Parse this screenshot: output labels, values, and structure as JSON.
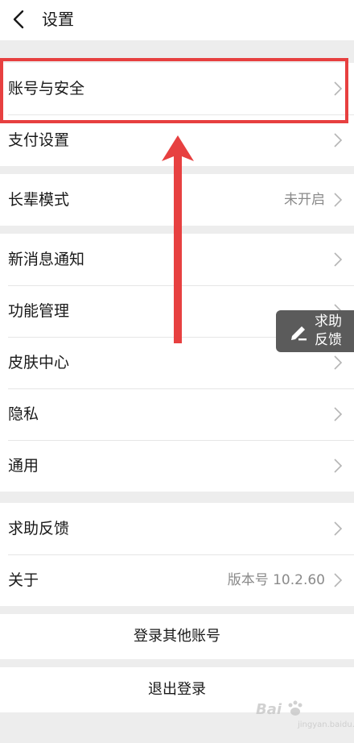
{
  "header": {
    "title": "设置"
  },
  "groups": [
    {
      "items": [
        {
          "label": "账号与安全",
          "value": ""
        },
        {
          "label": "支付设置",
          "value": ""
        }
      ]
    },
    {
      "items": [
        {
          "label": "长辈模式",
          "value": "未开启"
        }
      ]
    },
    {
      "items": [
        {
          "label": "新消息通知",
          "value": ""
        },
        {
          "label": "功能管理",
          "value": ""
        },
        {
          "label": "皮肤中心",
          "value": ""
        },
        {
          "label": "隐私",
          "value": ""
        },
        {
          "label": "通用",
          "value": ""
        }
      ]
    },
    {
      "items": [
        {
          "label": "求助反馈",
          "value": ""
        },
        {
          "label": "关于",
          "value": "版本号 10.2.60"
        }
      ]
    }
  ],
  "actions": {
    "switch_account": "登录其他账号",
    "logout": "退出登录"
  },
  "floating_feedback": {
    "line1": "求助",
    "line2": "反馈"
  },
  "watermark": {
    "text": "Bai",
    "sub": "jingyan.baidu.com"
  },
  "colors": {
    "highlight": "#e74040",
    "background": "#ededed",
    "secondary_text": "#8a8a8a"
  },
  "icons": [
    "back-arrow-icon",
    "chevron-right-icon",
    "pencil-edit-icon",
    "annotation-arrow-icon"
  ]
}
